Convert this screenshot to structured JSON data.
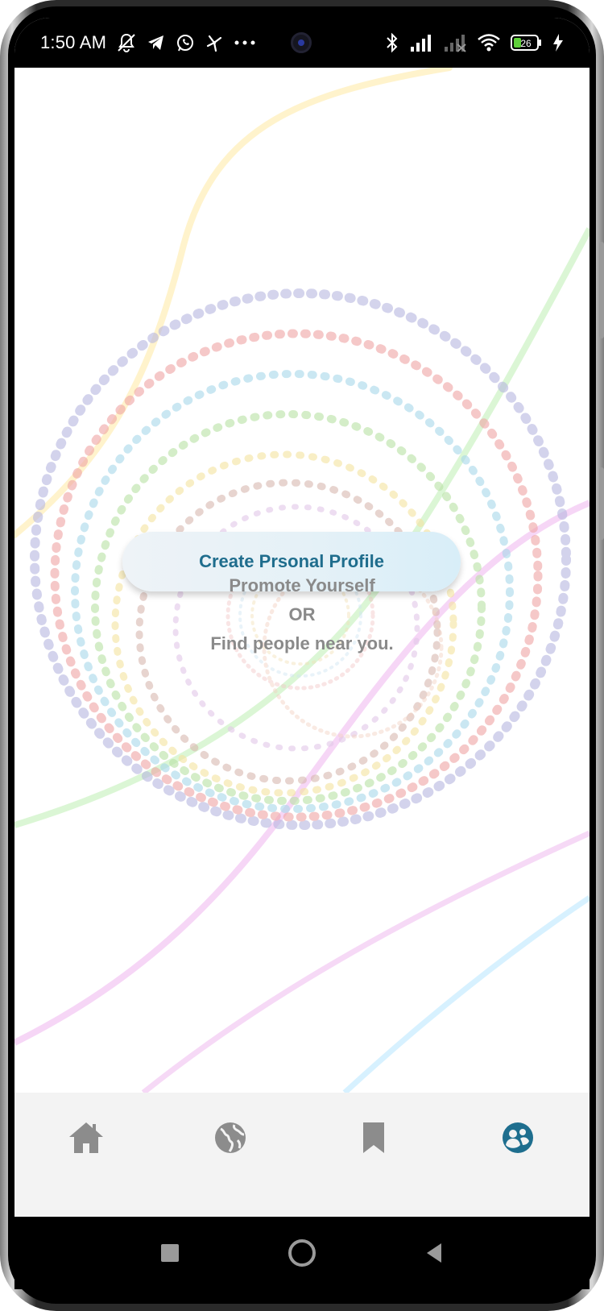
{
  "status_bar": {
    "time": "1:50 AM",
    "left_icons": [
      "mute-icon",
      "telegram-icon",
      "whatsapp-icon",
      "fan-icon",
      "more-dots-icon"
    ],
    "right_icons": [
      "bluetooth-icon",
      "signal-icon",
      "signal-no-service-icon",
      "wifi-icon",
      "battery-icon",
      "charging-icon"
    ],
    "battery_level": "26"
  },
  "main": {
    "create_profile_label": "Create Prsonal Profile",
    "promo_line1": "Promote Yourself",
    "promo_line2": "OR",
    "promo_line3": "Find people near you."
  },
  "bottom_nav": {
    "items": [
      {
        "icon": "home-icon",
        "active": false
      },
      {
        "icon": "globe-icon",
        "active": false
      },
      {
        "icon": "bookmark-icon",
        "active": false
      },
      {
        "icon": "people-icon",
        "active": true
      }
    ],
    "active_color": "#1e6e8e",
    "inactive_color": "#8c8c8c"
  },
  "system_nav": [
    "recent-apps-icon",
    "home-circle-icon",
    "back-icon"
  ]
}
